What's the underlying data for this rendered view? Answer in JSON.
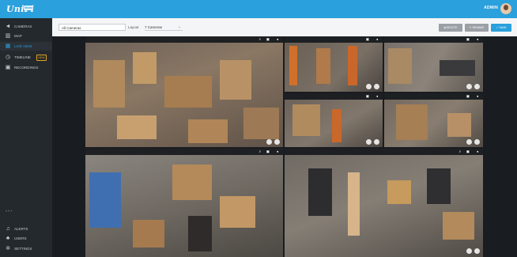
{
  "header": {
    "logo_text": "UniFi",
    "logo_badge": "Video",
    "user_label": "ADMIN"
  },
  "sidebar": {
    "items": [
      {
        "label": "CAMERAS",
        "icon": "camera-icon"
      },
      {
        "label": "MAP",
        "icon": "map-icon"
      },
      {
        "label": "LIVE VIEW",
        "icon": "grid-icon",
        "active": true
      },
      {
        "label": "TIMELINE",
        "icon": "clock-icon",
        "badge": "NEW"
      },
      {
        "label": "RECORDINGS",
        "icon": "recordings-icon"
      }
    ],
    "more": "•••",
    "bottom_items": [
      {
        "label": "ALERTS",
        "icon": "bell-icon"
      },
      {
        "label": "USERS",
        "icon": "users-icon"
      },
      {
        "label": "SETTINGS",
        "icon": "gear-icon"
      }
    ]
  },
  "toolbar": {
    "camera_filter_value": "All Cameras",
    "layout_label": "Layout",
    "layout_value": "7 Cameras",
    "delete_label": "DELETE",
    "rename_label": "RENAME",
    "save_label": "SAVE"
  },
  "cameras": [
    {
      "id": "cam-1"
    },
    {
      "id": "cam-2"
    },
    {
      "id": "cam-3"
    },
    {
      "id": "cam-4"
    },
    {
      "id": "cam-5"
    },
    {
      "id": "cam-6"
    },
    {
      "id": "cam-7"
    }
  ],
  "colors": {
    "accent": "#2aa0dc",
    "sidebar_bg": "#24292e",
    "badge": "#e0a323"
  }
}
